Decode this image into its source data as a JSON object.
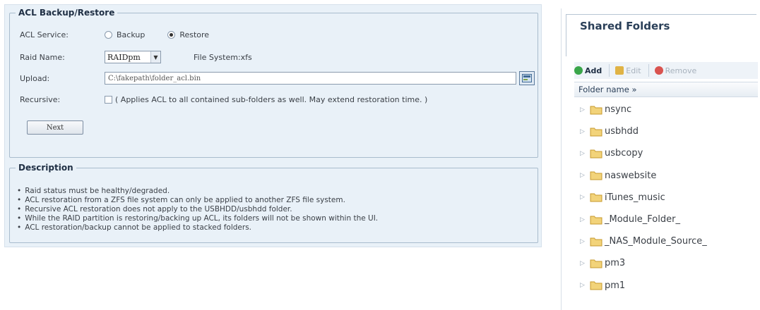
{
  "acl": {
    "legend": "ACL Backup/Restore",
    "service_label": "ACL Service:",
    "backup_label": "Backup",
    "restore_label": "Restore",
    "selected_service": "Restore",
    "raid_label": "Raid Name:",
    "raid_value": "RAIDpm",
    "fs_info": "File System:xfs",
    "upload_label": "Upload:",
    "upload_value": "C:\\fakepath\\folder_acl.bin",
    "recursive_label": "Recursive:",
    "recursive_text": "( Applies ACL to all contained sub-folders as well. May extend restoration time. )",
    "recursive_checked": false,
    "next_label": "Next"
  },
  "description": {
    "legend": "Description",
    "items": [
      "Raid status must be healthy/degraded.",
      "ACL restoration from a ZFS file system can only be applied to another ZFS file system.",
      "Recursive ACL restoration does not apply to the USBHDD/usbhdd folder.",
      "While the RAID partition is restoring/backing up ACL, its folders will not be shown within the UI.",
      "ACL restoration/backup cannot be applied to stacked folders."
    ]
  },
  "shared_folders": {
    "title": "Shared Folders",
    "toolbar": {
      "add": "Add",
      "edit": "Edit",
      "remove": "Remove"
    },
    "column_header": "Folder name »",
    "folders": [
      "nsync",
      "usbhdd",
      "usbcopy",
      "naswebsite",
      "iTunes_music",
      "_Module_Folder_",
      "_NAS_Module_Source_",
      "pm3",
      "pm1"
    ]
  },
  "colors": {
    "panel_bg": "#e9f1f8",
    "border": "#a9bccd",
    "folder": "#e8c65a",
    "add_green": "#3aa64a",
    "remove_red": "#d9534f"
  }
}
